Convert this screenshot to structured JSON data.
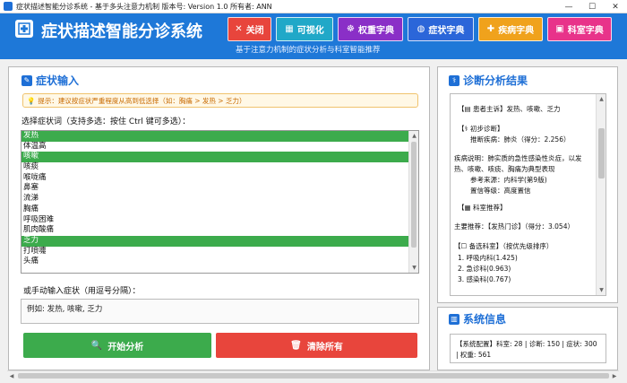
{
  "window": {
    "title": "症状描述智能分诊系统 - 基于多头注意力机制 版本号: Version 1.0  所有者: ANN"
  },
  "header": {
    "title": "症状描述智能分诊系统",
    "subtitle": "基于注意力机制的症状分析与科室智能推荐",
    "buttons": [
      {
        "label": "关闭",
        "icon": "close-icon",
        "glyph": "✕",
        "color": "#e8453c"
      },
      {
        "label": "可视化",
        "icon": "chart-icon",
        "glyph": "▦",
        "color": "#20a8c8"
      },
      {
        "label": "权重字典",
        "icon": "dictionary-icon",
        "glyph": "☸",
        "color": "#8a2fc7"
      },
      {
        "label": "症状字典",
        "icon": "symptom-dictionary-icon",
        "glyph": "◍",
        "color": "#2b66d9"
      },
      {
        "label": "疾病字典",
        "icon": "disease-dictionary-icon",
        "glyph": "✚",
        "color": "#f0a21c"
      },
      {
        "label": "科室字典",
        "icon": "department-dictionary-icon",
        "glyph": "▣",
        "color": "#e8338a"
      }
    ]
  },
  "input_panel": {
    "title": "症状输入",
    "tip": "提示：建议按症状严重程度从高到低选择（如：胸痛 > 发热 > 乏力）",
    "select_label": "选择症状词（支持多选：按住 Ctrl 键可多选）：",
    "symptoms": [
      {
        "label": "发热",
        "selected": true
      },
      {
        "label": "体温高",
        "selected": false
      },
      {
        "label": "咳嗽",
        "selected": true
      },
      {
        "label": "咳痰",
        "selected": false
      },
      {
        "label": "喉咙痛",
        "selected": false
      },
      {
        "label": "鼻塞",
        "selected": false
      },
      {
        "label": "流涕",
        "selected": false
      },
      {
        "label": "胸痛",
        "selected": false
      },
      {
        "label": "呼吸困难",
        "selected": false
      },
      {
        "label": "肌肉酸痛",
        "selected": false
      },
      {
        "label": "乏力",
        "selected": true
      },
      {
        "label": "打喷嚏",
        "selected": false
      },
      {
        "label": "头痛",
        "selected": false
      }
    ],
    "manual_label": "或手动输入症状（用逗号分隔）：",
    "manual_value": "例如: 发热, 咳嗽, 乏力",
    "analyze_label": "开始分析",
    "clear_label": "清除所有",
    "analyze_color": "#3cab4c",
    "clear_color": "#e8453c"
  },
  "result_panel": {
    "title": "诊断分析结果",
    "lines": [
      "【▤ 患者主诉】发热、咳嗽、乏力",
      "【⚕ 初步诊断】",
      "推断疾病：肺炎（得分：2.256）",
      "疾病说明：肺实质的急性感染性炎症，以发",
      "热、咳嗽、咳痰、胸痛为典型表现",
      "参考来源：内科学(第9版)",
      "置信等级：高度置信",
      "【▦ 科室推荐】",
      "主要推荐：【发热门诊】（得分：3.054）",
      "【☐ 备选科室】（按优先级排序）",
      "1. 呼吸内科(1.425)",
      "2. 急诊科(0.963)",
      "3. 感染科(0.767)"
    ]
  },
  "system_panel": {
    "title": "系统信息",
    "line1": "【系统配置】科室: 28 | 诊断: 150 | 症状: 300",
    "line2": "| 权重: 561"
  }
}
